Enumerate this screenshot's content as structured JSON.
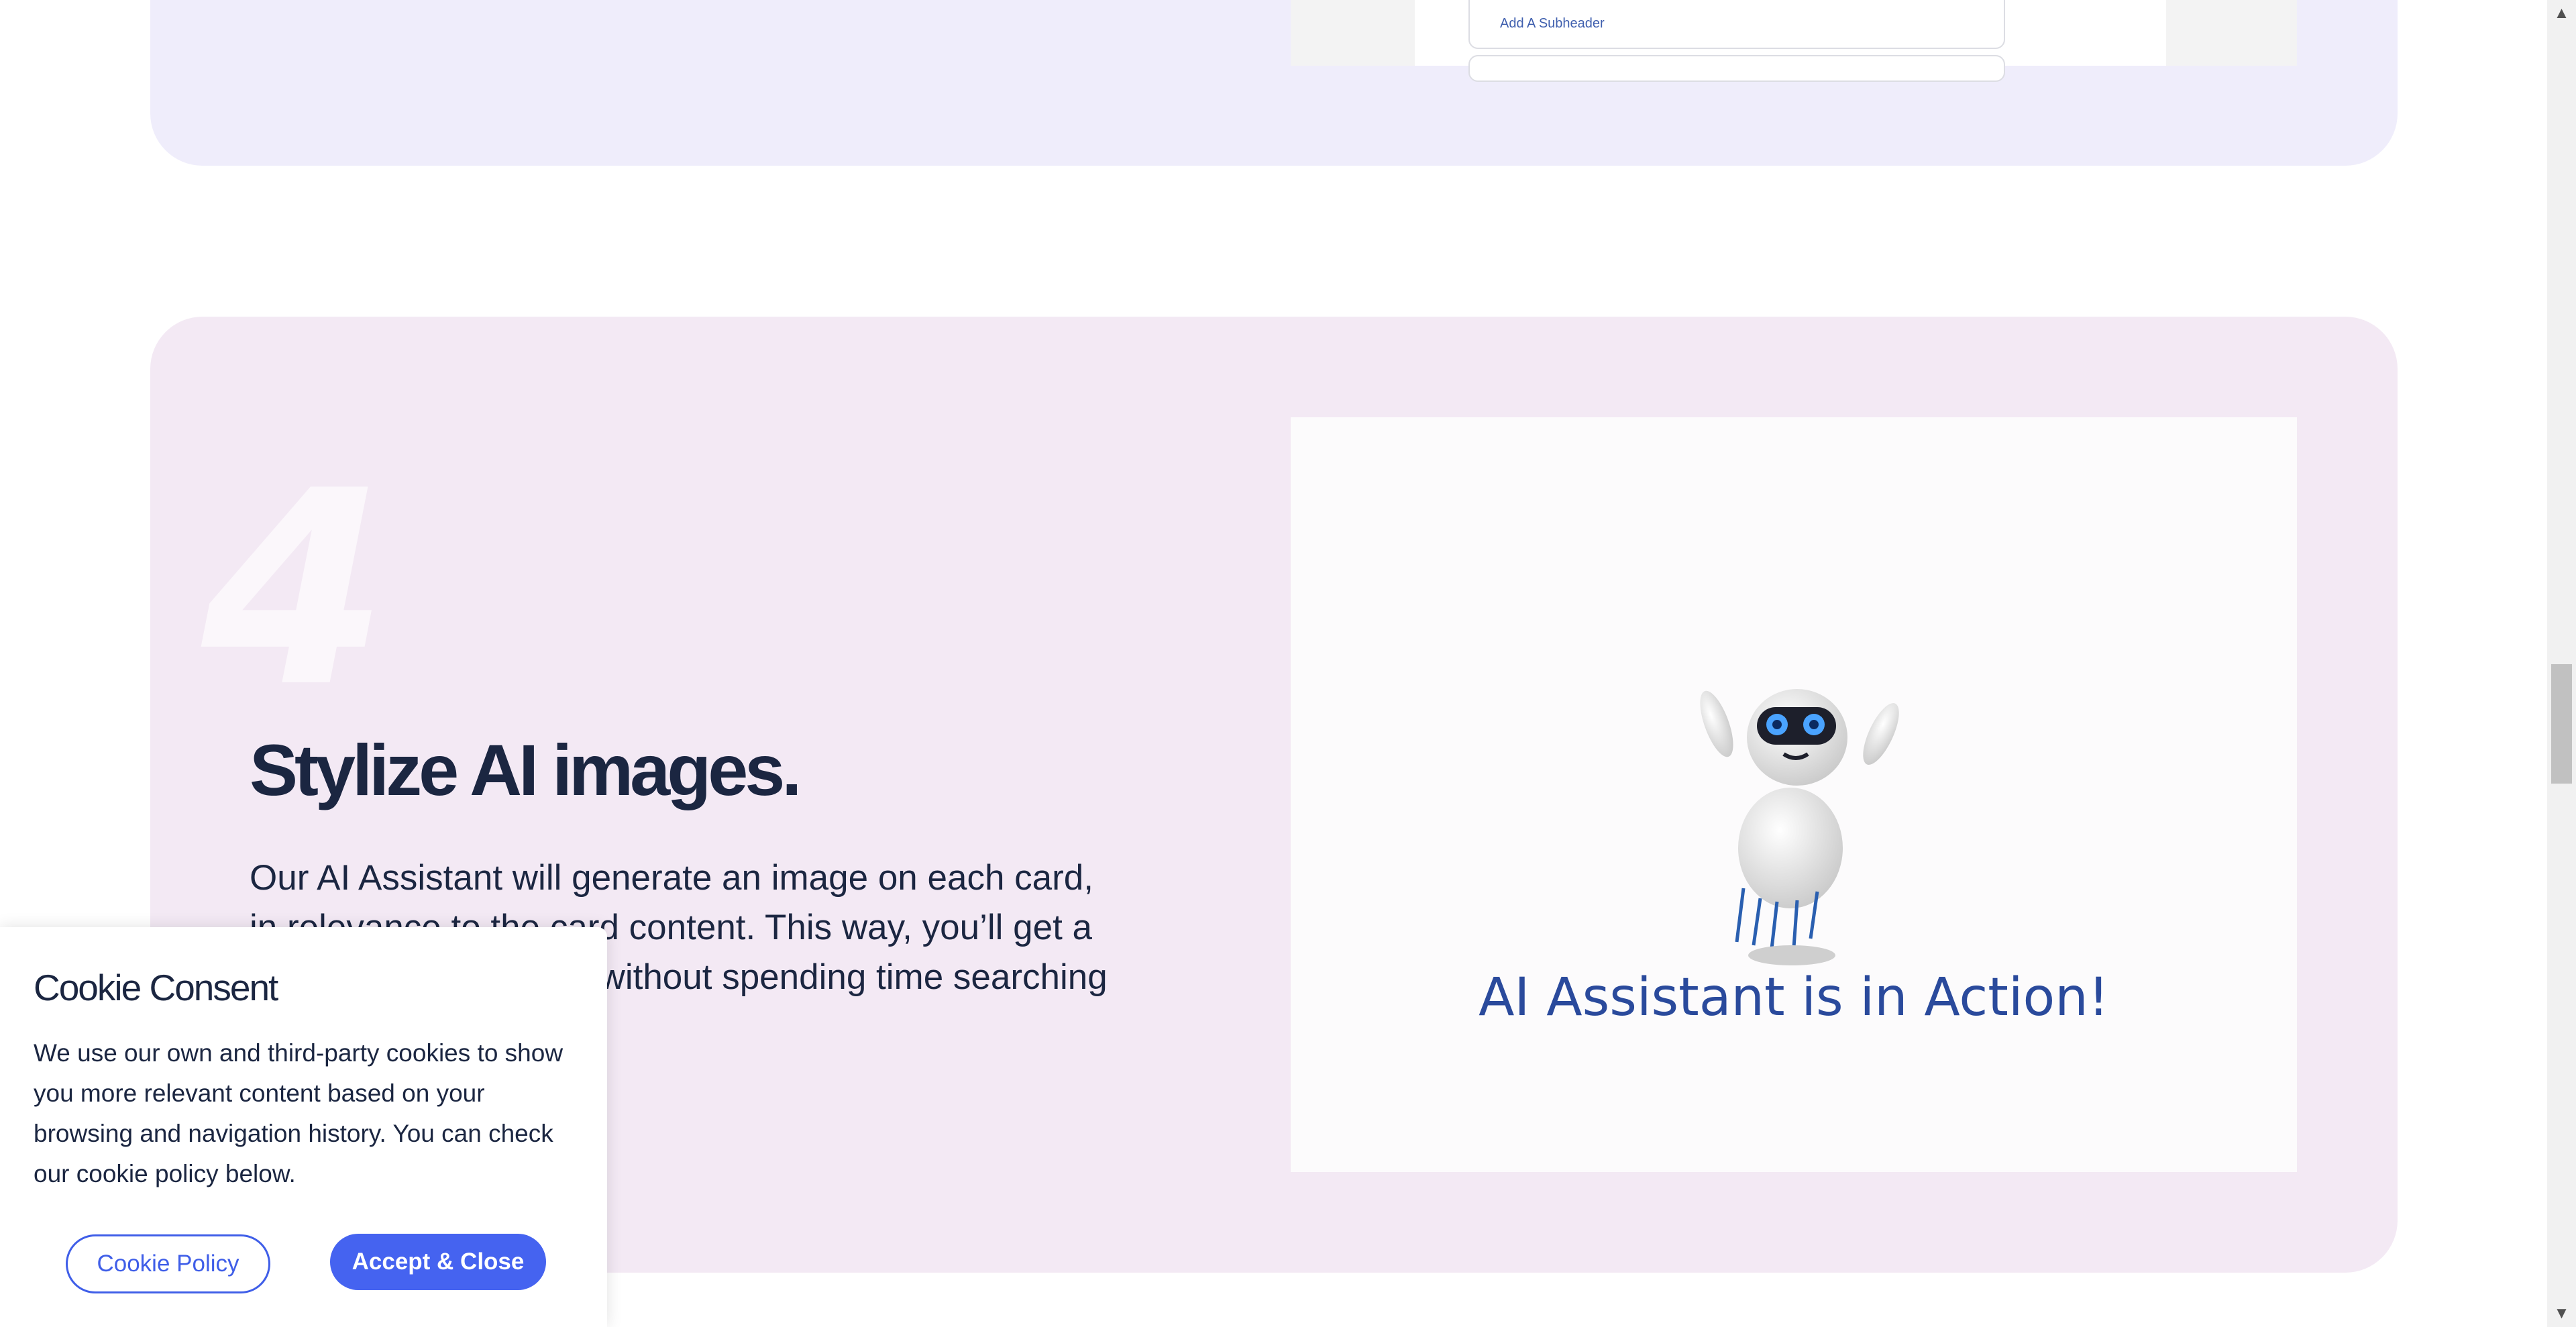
{
  "top_section": {
    "preview_link": "Add A Subheader"
  },
  "feature": {
    "number": "4",
    "heading": "Stylize AI images.",
    "body": "Our AI Assistant will generate an image on each card, in relevance to the card content. This way, you’ll get a stunning presentation without spending time searching and choosing images.",
    "media_caption": "AI Assistant is in Action!",
    "media_icon": "robot-icon"
  },
  "cookie_banner": {
    "title": "Cookie Consent",
    "text": "We use our own and third-party cookies to show you more relevant content based on your browsing and navigation history. You can check our cookie policy below.",
    "policy_button": "Cookie Policy",
    "accept_button": "Accept & Close"
  },
  "scrollbar": {
    "up_icon": "arrow-up-icon",
    "down_icon": "arrow-down-icon",
    "up_glyph": "▲",
    "down_glyph": "▼"
  },
  "colors": {
    "accent": "#4563f0",
    "heading": "#1b2641",
    "section_lavender": "#efedfb",
    "section_pink": "#f3e9f4"
  }
}
